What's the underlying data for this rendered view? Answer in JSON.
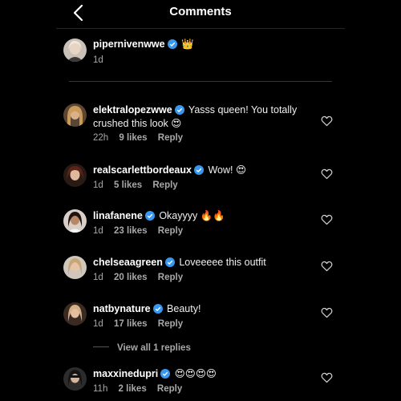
{
  "header": {
    "title": "Comments"
  },
  "caption": {
    "username": "pipernivenwwe",
    "emoji": "👑",
    "time": "1d"
  },
  "comments": [
    {
      "username": "elektralopezwwe",
      "text": "Yasss queen! You totally crushed this look 😍",
      "time": "22h",
      "likes": "9 likes",
      "reply": "Reply"
    },
    {
      "username": "realscarlettbordeaux",
      "text": "Wow! 😍",
      "time": "1d",
      "likes": "5 likes",
      "reply": "Reply"
    },
    {
      "username": "linafanene",
      "text": "Okayyyy 🔥🔥",
      "time": "1d",
      "likes": "23 likes",
      "reply": "Reply"
    },
    {
      "username": "chelseaagreen",
      "text": "Loveeeee this outfit",
      "time": "1d",
      "likes": "20 likes",
      "reply": "Reply"
    },
    {
      "username": "natbynature",
      "text": "Beauty!",
      "time": "1d",
      "likes": "17 likes",
      "reply": "Reply"
    },
    {
      "username": "maxxinedupri",
      "text": "😍😍😍😍",
      "time": "11h",
      "likes": "2 likes",
      "reply": "Reply"
    }
  ],
  "view_replies": "View all 1 replies",
  "colors": {
    "background": "#000000",
    "verified": "#3897f0",
    "meta": "#a8a8a8"
  }
}
